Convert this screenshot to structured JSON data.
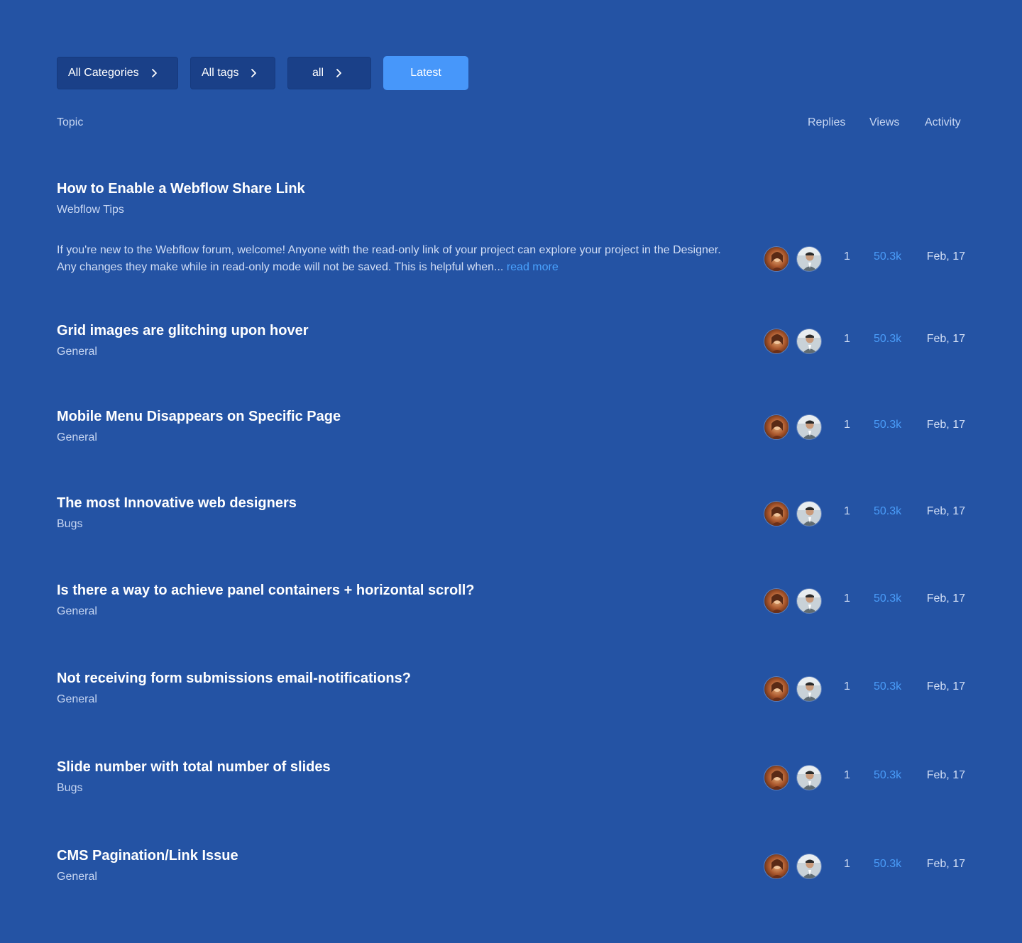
{
  "filters": {
    "categories_label": "All Categories",
    "tags_label": "All tags",
    "period_label": "all",
    "sort_label": "Latest"
  },
  "columns": {
    "topic": "Topic",
    "replies": "Replies",
    "views": "Views",
    "activity": "Activity"
  },
  "colors": {
    "background": "#2453a4",
    "button": "#1a4088",
    "accent": "#4797fa",
    "link": "#4aa3ff"
  },
  "topics": [
    {
      "title": "How to Enable a Webflow Share Link",
      "category": "Webflow Tips",
      "excerpt": "If you're new to the Webflow forum, welcome! Anyone with the read-only link of your project can explore your project in the Designer. Any changes they make while in read-only mode will not be saved. This is helpful when...",
      "read_more": "read more",
      "replies": "1",
      "views": "50.3k",
      "activity": "Feb, 17"
    },
    {
      "title": "Grid images are glitching upon hover",
      "category": "General",
      "replies": "1",
      "views": "50.3k",
      "activity": "Feb, 17"
    },
    {
      "title": "Mobile Menu Disappears on Specific Page",
      "category": "General",
      "replies": "1",
      "views": "50.3k",
      "activity": "Feb, 17"
    },
    {
      "title": "The most Innovative web designers",
      "category": "Bugs",
      "replies": "1",
      "views": "50.3k",
      "activity": "Feb, 17"
    },
    {
      "title": "Is there a way to achieve panel containers + horizontal scroll?",
      "category": "General",
      "replies": "1",
      "views": "50.3k",
      "activity": "Feb, 17"
    },
    {
      "title": "Not receiving form submissions email-notifications?",
      "category": "General",
      "replies": "1",
      "views": "50.3k",
      "activity": "Feb, 17"
    },
    {
      "title": "Slide number with total number of slides",
      "category": "Bugs",
      "replies": "1",
      "views": "50.3k",
      "activity": "Feb, 17"
    },
    {
      "title": "CMS Pagination/Link Issue",
      "category": "General",
      "replies": "1",
      "views": "50.3k",
      "activity": "Feb, 17"
    }
  ]
}
